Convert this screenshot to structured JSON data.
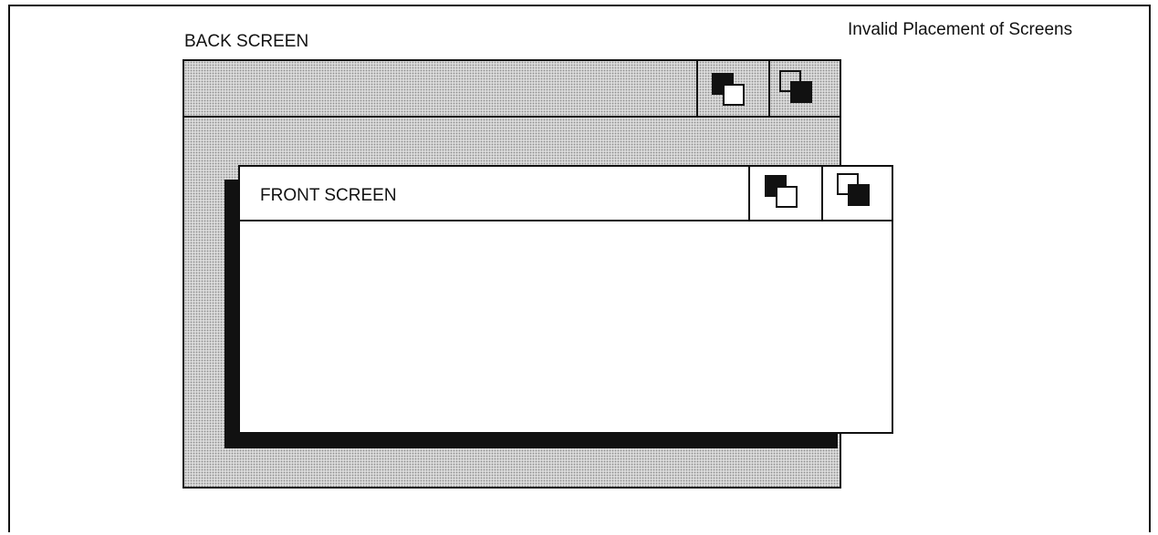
{
  "caption": "Invalid Placement of Screens",
  "back_screen": {
    "title": "BACK SCREEN",
    "buttons": [
      {
        "icon": "bring-to-front-icon"
      },
      {
        "icon": "send-to-back-icon"
      }
    ]
  },
  "front_screen": {
    "title": "FRONT SCREEN",
    "buttons": [
      {
        "icon": "bring-to-front-icon"
      },
      {
        "icon": "send-to-back-icon"
      }
    ]
  },
  "colors": {
    "ink": "#111111",
    "background": "#ffffff",
    "stipple": "#dadada"
  }
}
